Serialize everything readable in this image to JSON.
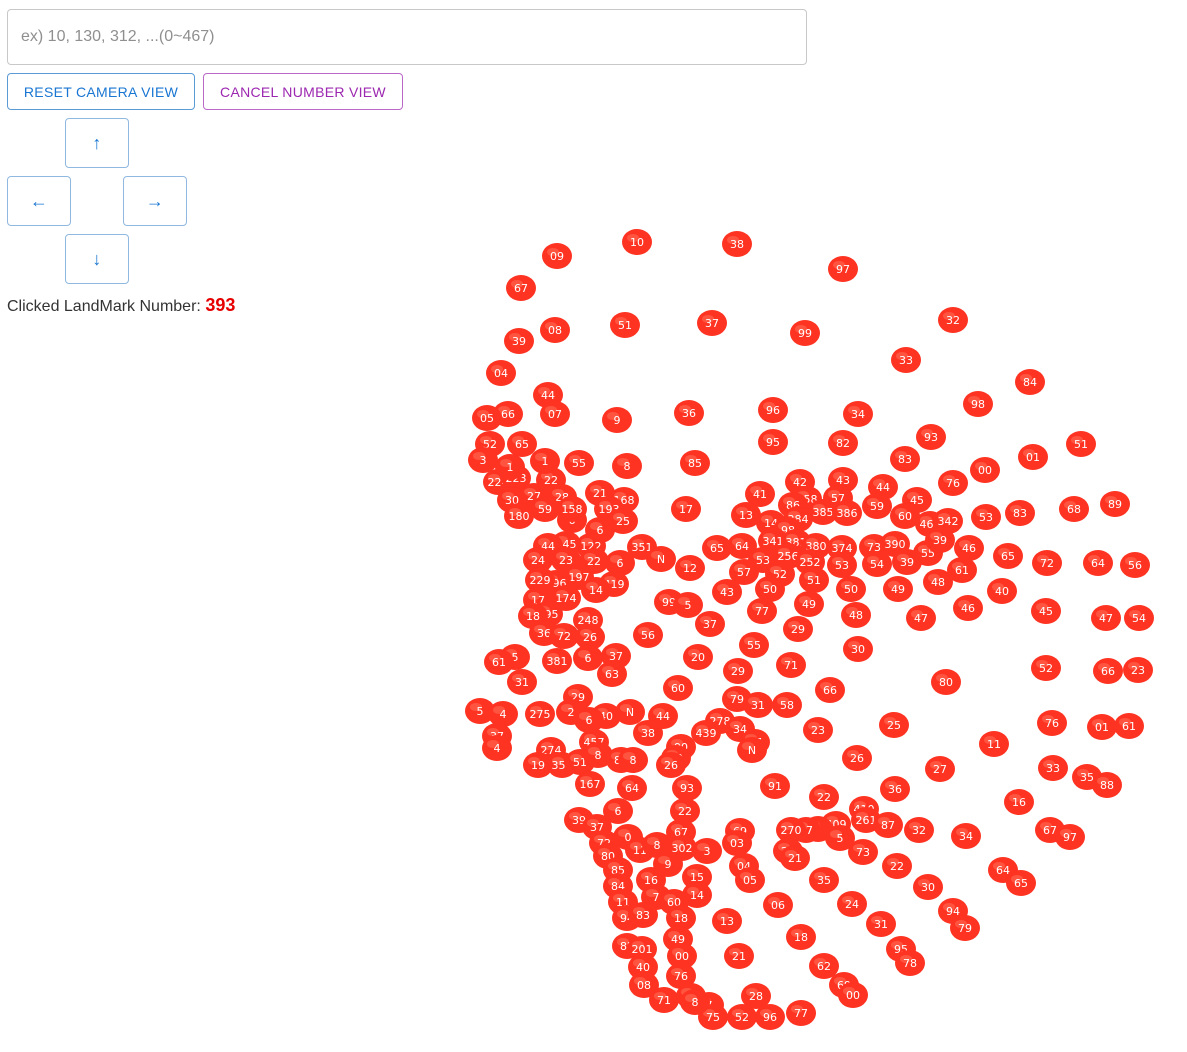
{
  "search": {
    "placeholder": "ex) 10, 130, 312, ...(0~467)",
    "value": ""
  },
  "buttons": {
    "reset_camera": "RESET CAMERA VIEW",
    "cancel_number": "CANCEL NUMBER VIEW"
  },
  "arrows": {
    "up": "↑",
    "left": "←",
    "right": "→",
    "down": "↓"
  },
  "status": {
    "label": "Clicked LandMark Number:",
    "value": "393"
  },
  "colors": {
    "landmark": "#ff3322",
    "landmark_label": "#ffffff",
    "reset_button": "#1976d2",
    "cancel_button": "#9c27b0",
    "clicked_value": "#e60000"
  },
  "viewer": {
    "landmark_range": "0~467"
  }
}
